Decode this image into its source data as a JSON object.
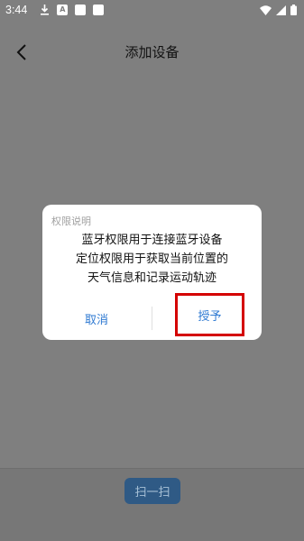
{
  "status_bar": {
    "time": "3:44",
    "left_icons": [
      "download-icon",
      "app-icon",
      "square-icon",
      "square-icon"
    ],
    "right_icons": [
      "wifi-icon",
      "signal-icon",
      "battery-icon"
    ],
    "app_icon_letter": "A"
  },
  "header": {
    "title": "添加设备",
    "back_icon": "chevron-left-icon"
  },
  "dialog": {
    "title": "权限说明",
    "message_lines": [
      "蓝牙权限用于连接蓝牙设备",
      "定位权限用于获取当前位置的",
      "天气信息和记录运动轨迹"
    ],
    "cancel_label": "取消",
    "grant_label": "授予"
  },
  "bottom": {
    "scan_label": "扫一扫"
  },
  "colors": {
    "overlay_bg": "#7f7f7f",
    "button_text": "#2f7ad2",
    "highlight_border": "#d40000",
    "scan_button_bg": "#2f5a85"
  }
}
